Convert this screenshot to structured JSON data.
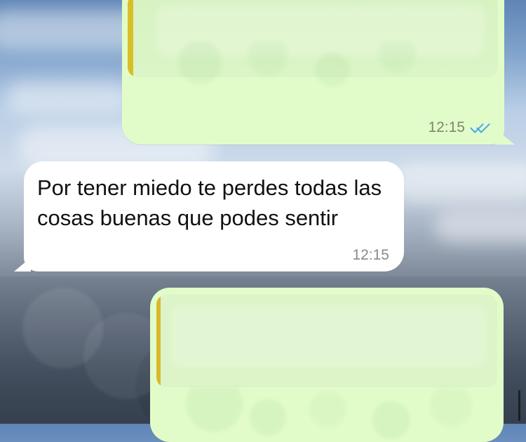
{
  "messages": [
    {
      "type": "outgoing",
      "time": "12:15",
      "status": "read",
      "status_icon": "double-check-icon",
      "accent_color": "#4aa7f2"
    },
    {
      "type": "incoming",
      "text": "Por tener miedo te perdes todas las cosas buenas que podes sentir",
      "time": "12:15"
    },
    {
      "type": "outgoing"
    }
  ],
  "colors": {
    "outgoing_bubble": "#e2fcc9",
    "incoming_bubble": "#ffffff",
    "quote_bar": "#d9b82c"
  }
}
